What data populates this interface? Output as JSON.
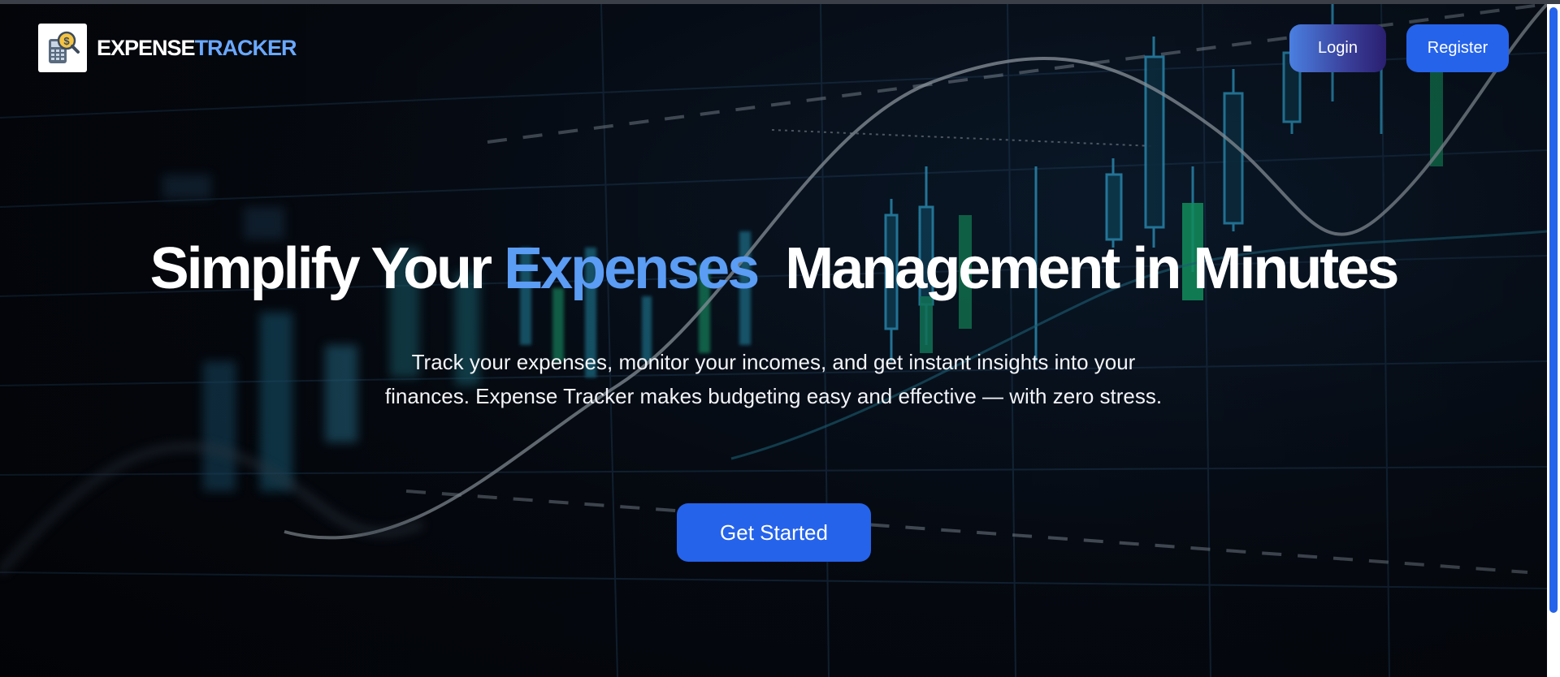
{
  "brand": {
    "name_part1": "EXPENSE",
    "name_part2": "TRACKER",
    "logo_icon": "calculator-dollar-magnifier-icon"
  },
  "nav": {
    "login_label": "Login",
    "register_label": "Register"
  },
  "hero": {
    "headline_part1": "Simplify Your ",
    "headline_accent": "Expenses",
    "headline_part2": "  Management in Minutes",
    "subtext": "Track your expenses, monitor your incomes, and get instant insights into your finances. Expense Tracker makes budgeting easy and effective — with zero stress.",
    "cta_label": "Get Started",
    "background": "stock-candlestick-chart-background"
  },
  "colors": {
    "accent_blue": "#2563eb",
    "headline_accent": "#5b9cf5",
    "brand_accent": "#6aa8ff",
    "background": "#05070c"
  }
}
